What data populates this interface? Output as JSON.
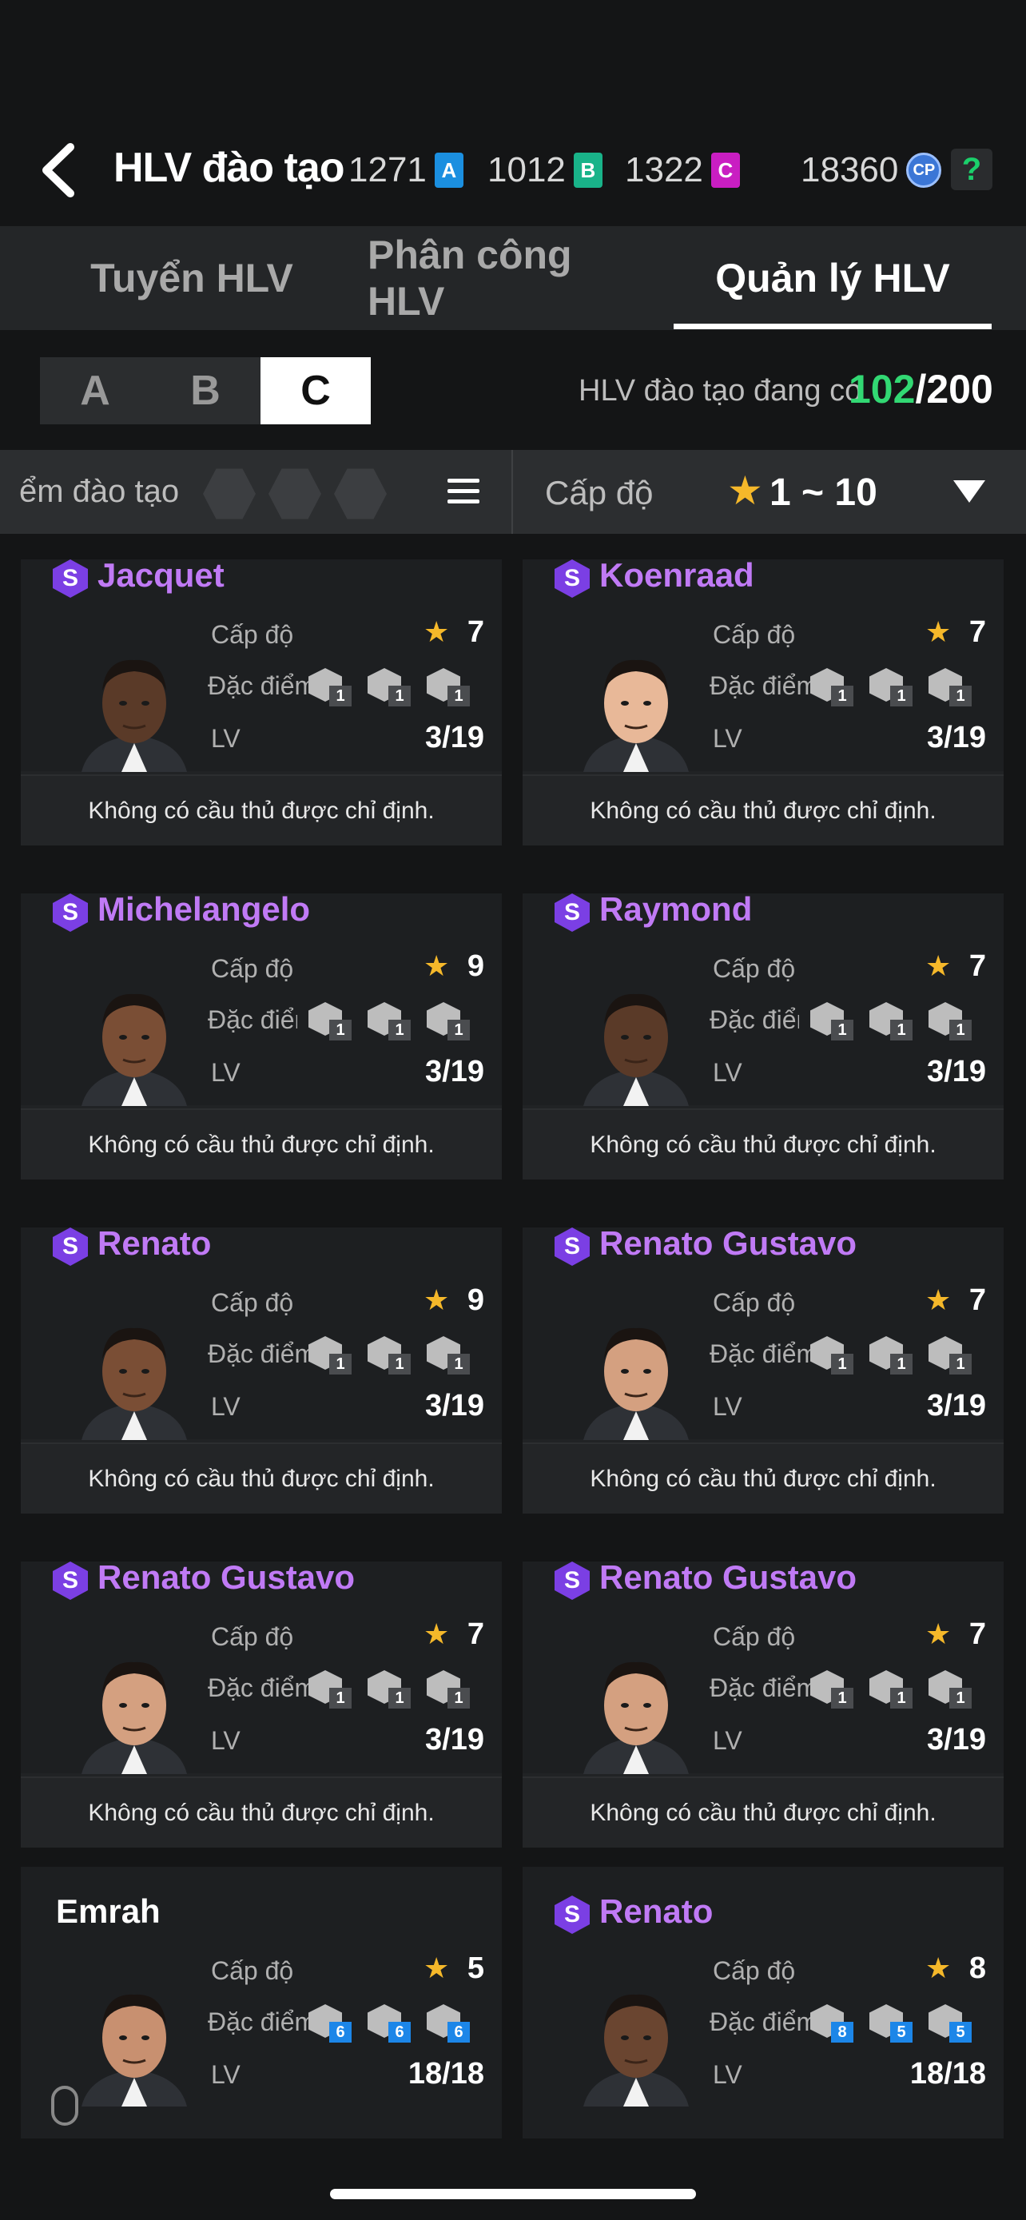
{
  "header": {
    "title": "HLV đào tạo",
    "currencies": [
      {
        "value": "1271",
        "tag": "A",
        "color": "#1b8fe0"
      },
      {
        "value": "1012",
        "tag": "B",
        "color": "#19b389"
      },
      {
        "value": "1322",
        "tag": "C",
        "color": "#c91ec2"
      }
    ],
    "cp_value": "18360",
    "cp_label": "CP",
    "help_label": "?"
  },
  "tabs": [
    "Tuyển HLV",
    "Phân công  HLV",
    "Quản lý HLV"
  ],
  "active_tab": 2,
  "groups": [
    "A",
    "B",
    "C"
  ],
  "active_group": 2,
  "count": {
    "label": "HLV đào tạo đang có",
    "current": "102",
    "total": "/200"
  },
  "filter": {
    "trait_label": "ểm đào tạo",
    "level_label": "Cấp độ",
    "level_range": "1 ~ 10"
  },
  "labels": {
    "level": "Cấp độ",
    "traits": "Đặc điểm",
    "lv": "LV",
    "star": "★",
    "badge": "S"
  },
  "cards": [
    {
      "name": "Jacquet",
      "badge": true,
      "level": "7",
      "lv": "3/19",
      "traits": [
        "1",
        "1",
        "1"
      ],
      "blue": false,
      "skin": "#5a3a28",
      "footer": "Không có cầu thủ được chỉ định."
    },
    {
      "name": "Koenraad",
      "badge": true,
      "level": "7",
      "lv": "3/19",
      "traits": [
        "1",
        "1",
        "1"
      ],
      "blue": false,
      "skin": "#e8b898",
      "footer": "Không có cầu thủ được chỉ định."
    },
    {
      "name": "Michelangelo",
      "badge": true,
      "level": "9",
      "lv": "3/19",
      "traits": [
        "1",
        "1",
        "1"
      ],
      "blue": false,
      "skin": "#7a4e35",
      "footer": "Không có cầu thủ được chỉ định."
    },
    {
      "name": "Raymond",
      "badge": true,
      "level": "7",
      "lv": "3/19",
      "traits": [
        "1",
        "1",
        "1"
      ],
      "blue": false,
      "skin": "#5a3a28",
      "footer": "Không có cầu thủ được chỉ định."
    },
    {
      "name": "Renato",
      "badge": true,
      "level": "9",
      "lv": "3/19",
      "traits": [
        "1",
        "1",
        "1"
      ],
      "blue": false,
      "skin": "#7a4e35",
      "footer": "Không có cầu thủ được chỉ định."
    },
    {
      "name": "Renato Gustavo",
      "badge": true,
      "level": "7",
      "lv": "3/19",
      "traits": [
        "1",
        "1",
        "1"
      ],
      "blue": false,
      "skin": "#d4a080",
      "footer": "Không có cầu thủ được chỉ định."
    },
    {
      "name": "Renato Gustavo",
      "badge": true,
      "level": "7",
      "lv": "3/19",
      "traits": [
        "1",
        "1",
        "1"
      ],
      "blue": false,
      "skin": "#d4a080",
      "footer": "Không có cầu thủ được chỉ định."
    },
    {
      "name": "Renato Gustavo",
      "badge": true,
      "level": "7",
      "lv": "3/19",
      "traits": [
        "1",
        "1",
        "1"
      ],
      "blue": false,
      "skin": "#d4a080",
      "footer": "Không có cầu thủ được chỉ định."
    },
    {
      "name": "Emrah",
      "badge": false,
      "level": "5",
      "lv": "18/18",
      "traits": [
        "6",
        "6",
        "6"
      ],
      "blue": true,
      "skin": "#c89070",
      "footer": ""
    },
    {
      "name": "Renato",
      "badge": true,
      "level": "8",
      "lv": "18/18",
      "traits": [
        "8",
        "5",
        "5"
      ],
      "blue": true,
      "skin": "#6a4530",
      "footer": ""
    }
  ]
}
